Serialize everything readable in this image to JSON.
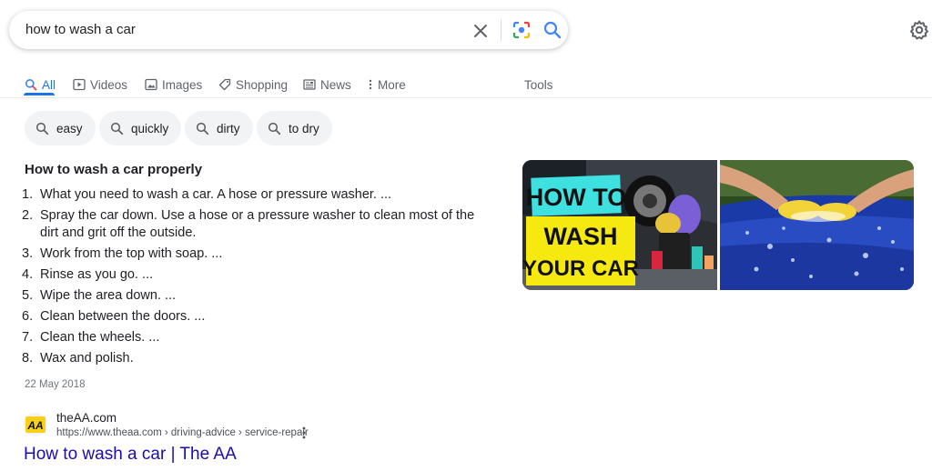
{
  "search": {
    "query": "how to wash a car"
  },
  "tabs": [
    {
      "label": "All",
      "icon": "search-icon"
    },
    {
      "label": "Videos",
      "icon": "play-icon"
    },
    {
      "label": "Images",
      "icon": "image-icon"
    },
    {
      "label": "Shopping",
      "icon": "tag-icon"
    },
    {
      "label": "News",
      "icon": "news-icon"
    },
    {
      "label": "More",
      "icon": "more-vert-icon"
    }
  ],
  "tools_label": "Tools",
  "chips": [
    "easy",
    "quickly",
    "dirty",
    "to dry"
  ],
  "snippet": {
    "title": "How to wash a car properly",
    "steps": [
      {
        "num": "1.",
        "text": "What you need to wash a car. A hose or pressure washer. ..."
      },
      {
        "num": "2.",
        "text": "Spray the car down. Use a hose or a pressure washer to clean most of the dirt and grit off the outside."
      },
      {
        "num": "3.",
        "text": "Work from the top with soap. ..."
      },
      {
        "num": "4.",
        "text": "Rinse as you go. ..."
      },
      {
        "num": "5.",
        "text": "Wipe the area down. ..."
      },
      {
        "num": "6.",
        "text": "Clean between the doors. ..."
      },
      {
        "num": "7.",
        "text": "Clean the wheels. ..."
      },
      {
        "num": "8.",
        "text": "Wax and polish."
      }
    ],
    "date": "22 May 2018",
    "thumbnail_text": [
      "HOW TO",
      "WASH",
      "YOUR CAR"
    ]
  },
  "result": {
    "favicon_text": "AA",
    "site_name": "theAA.com",
    "url": "https://www.theaa.com › driving-advice › service-repair",
    "title": "How to wash a car | The AA"
  },
  "colors": {
    "accent": "#1a73e8",
    "link": "#1a0dab",
    "thumbnail_yellow": "#f5e90f",
    "thumbnail_cyan": "#3fe0e0",
    "car_blue": "#1a3aa8"
  }
}
